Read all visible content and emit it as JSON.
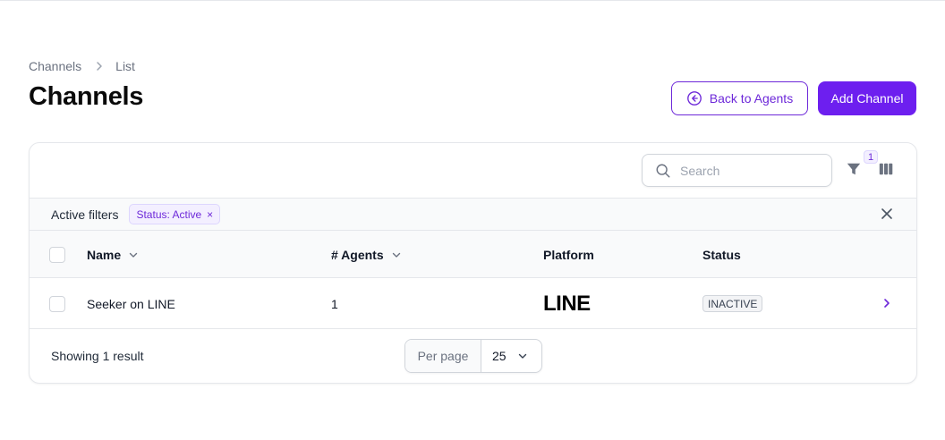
{
  "breadcrumb": {
    "parent": "Channels",
    "current": "List"
  },
  "page": {
    "title": "Channels"
  },
  "actions": {
    "back_label": "Back to Agents",
    "add_label": "Add Channel"
  },
  "toolbar": {
    "search_placeholder": "Search",
    "filter_count": "1",
    "icons": [
      "search-icon",
      "filter-icon",
      "columns-icon"
    ]
  },
  "filters": {
    "label": "Active filters",
    "chips": [
      {
        "label": "Status: Active",
        "remove": "×"
      }
    ]
  },
  "table": {
    "columns": [
      {
        "label": "Name",
        "sortable": true
      },
      {
        "label": "# Agents",
        "sortable": true
      },
      {
        "label": "Platform",
        "sortable": false
      },
      {
        "label": "Status",
        "sortable": false
      }
    ],
    "rows": [
      {
        "name": "Seeker on LINE",
        "agents": "1",
        "platform": "LINE",
        "status": "INACTIVE"
      }
    ]
  },
  "pagination": {
    "summary": "Showing 1 result",
    "per_page_label": "Per page",
    "per_page_value": "25"
  },
  "colors": {
    "accent": "#6d1fef",
    "accent_text": "#6d28d9",
    "border": "#e5e7eb"
  }
}
